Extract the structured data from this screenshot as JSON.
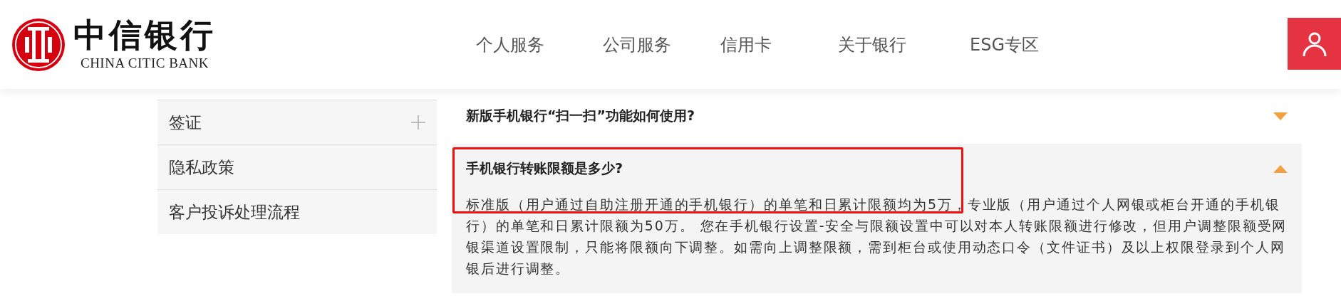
{
  "logo": {
    "name": "中信银行",
    "subtitle": "CHINA CITIC BANK"
  },
  "nav": [
    {
      "label": "个人服务"
    },
    {
      "label": "公司服务"
    },
    {
      "label": "信用卡"
    },
    {
      "label": "关于银行"
    },
    {
      "label": "ESG专区"
    }
  ],
  "sidebar": {
    "items": [
      {
        "label": "签证",
        "expandable": true
      },
      {
        "label": "隐私政策",
        "expandable": false
      },
      {
        "label": "客户投诉处理流程",
        "expandable": false
      }
    ]
  },
  "faq": [
    {
      "question": "新版手机银行“扫一扫”功能如何使用?",
      "expanded": false
    },
    {
      "question": "手机银行转账限额是多少?",
      "expanded": true,
      "answer": "标准版（用户通过自助注册开通的手机银行）的单笔和日累计限额均为5万，专业版（用户通过个人网银或柜台开通的手机银行）的单笔和日累计限额为50万。 您在手机银行设置-安全与限额设置中可以对本人转账限额进行修改，但用户调整限额受网银渠道设置限制，只能将限额向下调整。如需向上调整限额，需到柜台或使用动态口令（文件证书）及以上权限登录到个人网银后进行调整。"
    }
  ]
}
